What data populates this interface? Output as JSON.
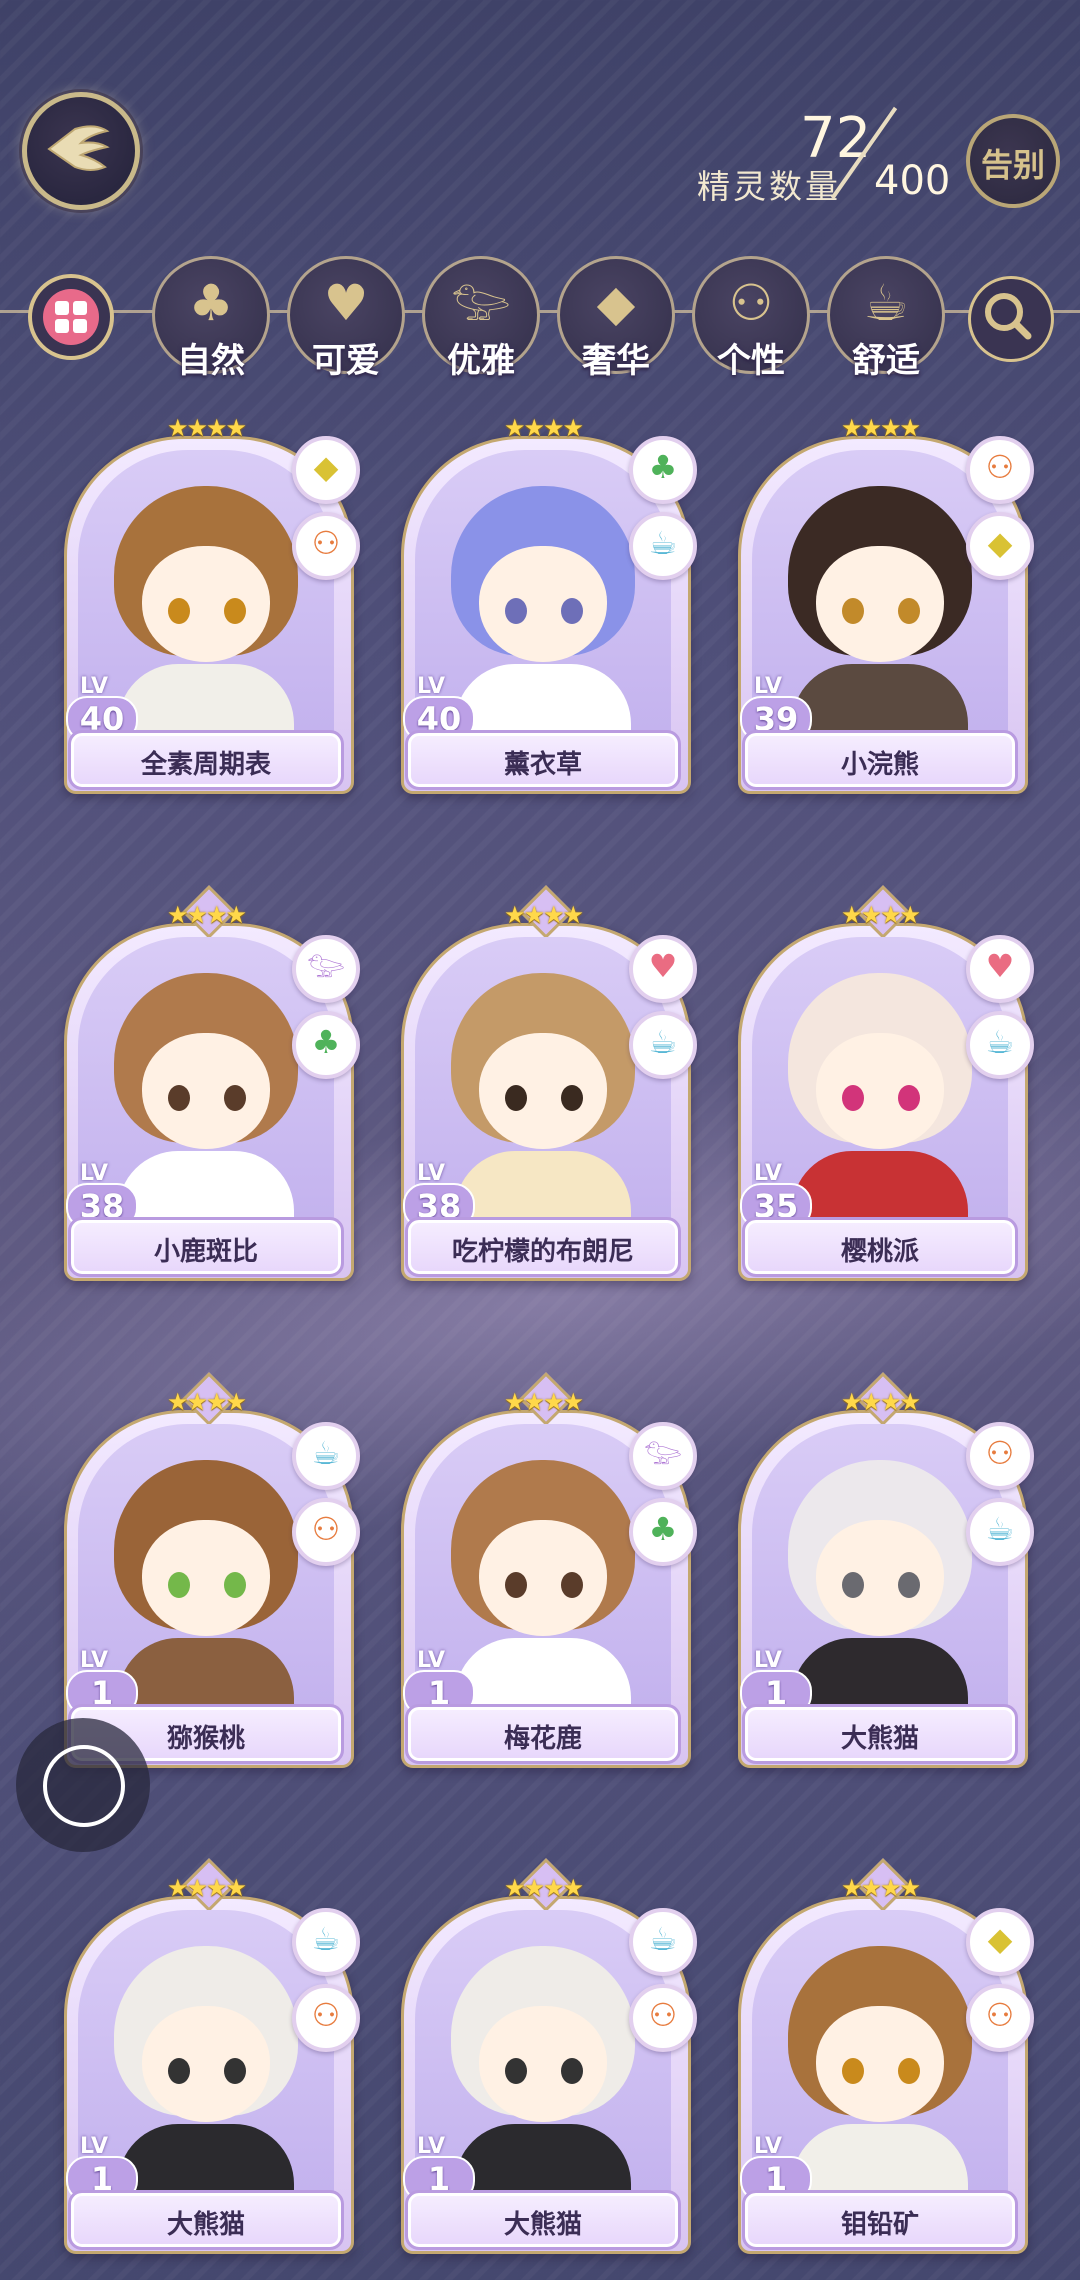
{
  "header": {
    "back_icon": "back-wing-icon",
    "count_label": "精灵数量",
    "count_current": "72",
    "count_max": "400",
    "farewell_label": "告别"
  },
  "categories": {
    "all_icon": "grid-icon",
    "items": [
      {
        "label": "自然",
        "icon": "clover-icon",
        "glyph": "♣"
      },
      {
        "label": "可爱",
        "icon": "heart-icon",
        "glyph": "♥"
      },
      {
        "label": "优雅",
        "icon": "swan-icon",
        "glyph": "𓅰"
      },
      {
        "label": "奢华",
        "icon": "diamond-icon",
        "glyph": "◆"
      },
      {
        "label": "个性",
        "icon": "glasses-icon",
        "glyph": "⚇"
      },
      {
        "label": "舒适",
        "icon": "teacup-icon",
        "glyph": "☕"
      }
    ],
    "search_icon": "search-icon"
  },
  "cards": [
    {
      "name": "全素周期表",
      "level": "40",
      "stars": "★★★★",
      "badges": [
        "diamond",
        "glasses"
      ],
      "hair": "#a8723c",
      "eye": "#c98a1c",
      "outfit": "#f1efe9"
    },
    {
      "name": "薰衣草",
      "level": "40",
      "stars": "★★★★",
      "badges": [
        "clover",
        "teacup"
      ],
      "hair": "#8a92e8",
      "eye": "#6e6fb8",
      "outfit": "#ffffff"
    },
    {
      "name": "小浣熊",
      "level": "39",
      "stars": "★★★★",
      "badges": [
        "glasses",
        "diamond"
      ],
      "hair": "#3b2a24",
      "eye": "#c28a2a",
      "outfit": "#5b4a40"
    },
    {
      "name": "小鹿斑比",
      "level": "38",
      "stars": "★★★★",
      "badges": [
        "swan",
        "clover"
      ],
      "hair": "#b07a4c",
      "eye": "#5a3c2a",
      "outfit": "#ffffff"
    },
    {
      "name": "吃柠檬的布朗尼",
      "level": "38",
      "stars": "★★★★",
      "badges": [
        "heart",
        "teacup"
      ],
      "hair": "#c49a68",
      "eye": "#3a2a20",
      "outfit": "#f6e7c4"
    },
    {
      "name": "樱桃派",
      "level": "35",
      "stars": "★★★★",
      "badges": [
        "heart",
        "teacup"
      ],
      "hair": "#f4e6de",
      "eye": "#d2347a",
      "outfit": "#c83234"
    },
    {
      "name": "猕猴桃",
      "level": "1",
      "stars": "★★★★",
      "badges": [
        "teacup",
        "glasses"
      ],
      "hair": "#9a6438",
      "eye": "#74b84a",
      "outfit": "#8b6040"
    },
    {
      "name": "梅花鹿",
      "level": "1",
      "stars": "★★★★",
      "badges": [
        "swan",
        "clover"
      ],
      "hair": "#b07a4c",
      "eye": "#5a3c2a",
      "outfit": "#ffffff"
    },
    {
      "name": "大熊猫",
      "level": "1",
      "stars": "★★★★",
      "badges": [
        "glasses",
        "teacup"
      ],
      "hair": "#ece8ec",
      "eye": "#6a6a70",
      "outfit": "#2e2a2e"
    },
    {
      "name": "大熊猫",
      "level": "1",
      "stars": "★★★★",
      "badges": [
        "teacup",
        "glasses"
      ],
      "hair": "#efece8",
      "eye": "#333333",
      "outfit": "#2b2a2e"
    },
    {
      "name": "大熊猫",
      "level": "1",
      "stars": "★★★★",
      "badges": [
        "teacup",
        "glasses"
      ],
      "hair": "#efece8",
      "eye": "#333333",
      "outfit": "#2b2a2e"
    },
    {
      "name": "钼铅矿",
      "level": "1",
      "stars": "★★★★",
      "badges": [
        "diamond",
        "glasses"
      ],
      "hair": "#a8723c",
      "eye": "#c98a1c",
      "outfit": "#f1efe9"
    }
  ],
  "level_tag": "LV",
  "badge_glyphs": {
    "diamond": "◆",
    "glasses": "⚇",
    "clover": "♣",
    "teacup": "☕",
    "swan": "𓅰",
    "heart": "♥"
  },
  "badge_colors": {
    "diamond": "#d9c234",
    "glasses": "#e77c3f",
    "clover": "#4fb25a",
    "teacup": "#5ab8d6",
    "swan": "#b07ad6",
    "heart": "#ea6c82"
  },
  "floating_button_icon": "assistive-touch-icon"
}
